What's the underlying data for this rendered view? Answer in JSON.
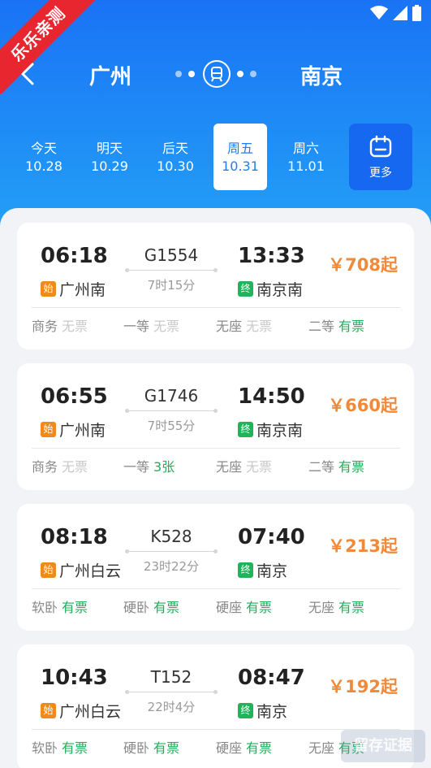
{
  "watermark_ribbon": "乐乐亲测",
  "route": {
    "from_city": "广州",
    "to_city": "南京"
  },
  "dates": [
    {
      "weekday": "今天",
      "date": "10.28",
      "active": false
    },
    {
      "weekday": "明天",
      "date": "10.29",
      "active": false
    },
    {
      "weekday": "后天",
      "date": "10.30",
      "active": false
    },
    {
      "weekday": "周五",
      "date": "10.31",
      "active": true
    },
    {
      "weekday": "周六",
      "date": "11.01",
      "active": false
    }
  ],
  "more_label": "更多",
  "tags": {
    "start": "始",
    "end": "终"
  },
  "trains": [
    {
      "dep_time": "06:18",
      "arr_time": "13:33",
      "train_no": "G1554",
      "duration": "7时15分",
      "from_station": "广州南",
      "to_station": "南京南",
      "price": "￥708起",
      "seats": [
        {
          "class": "商务",
          "availability": "无票"
        },
        {
          "class": "一等",
          "availability": "无票"
        },
        {
          "class": "无座",
          "availability": "无票"
        },
        {
          "class": "二等",
          "availability": "有票"
        }
      ]
    },
    {
      "dep_time": "06:55",
      "arr_time": "14:50",
      "train_no": "G1746",
      "duration": "7时55分",
      "from_station": "广州南",
      "to_station": "南京南",
      "price": "￥660起",
      "seats": [
        {
          "class": "商务",
          "availability": "无票"
        },
        {
          "class": "一等",
          "availability": "3张"
        },
        {
          "class": "无座",
          "availability": "无票"
        },
        {
          "class": "二等",
          "availability": "有票"
        }
      ]
    },
    {
      "dep_time": "08:18",
      "arr_time": "07:40",
      "train_no": "K528",
      "duration": "23时22分",
      "from_station": "广州白云",
      "to_station": "南京",
      "price": "￥213起",
      "seats": [
        {
          "class": "软卧",
          "availability": "有票"
        },
        {
          "class": "硬卧",
          "availability": "有票"
        },
        {
          "class": "硬座",
          "availability": "有票"
        },
        {
          "class": "无座",
          "availability": "有票"
        }
      ]
    },
    {
      "dep_time": "10:43",
      "arr_time": "08:47",
      "train_no": "T152",
      "duration": "22时4分",
      "from_station": "广州白云",
      "to_station": "南京",
      "price": "￥192起",
      "seats": [
        {
          "class": "软卧",
          "availability": "有票"
        },
        {
          "class": "硬卧",
          "availability": "有票"
        },
        {
          "class": "硬座",
          "availability": "有票"
        },
        {
          "class": "无座",
          "availability": "有票"
        }
      ]
    }
  ],
  "bottom_watermark": "留存证据",
  "colors": {
    "header": "#1f7ef5",
    "price": "#f08a3a",
    "available": "#1fae5a",
    "unavailable": "#c8c8c8"
  }
}
